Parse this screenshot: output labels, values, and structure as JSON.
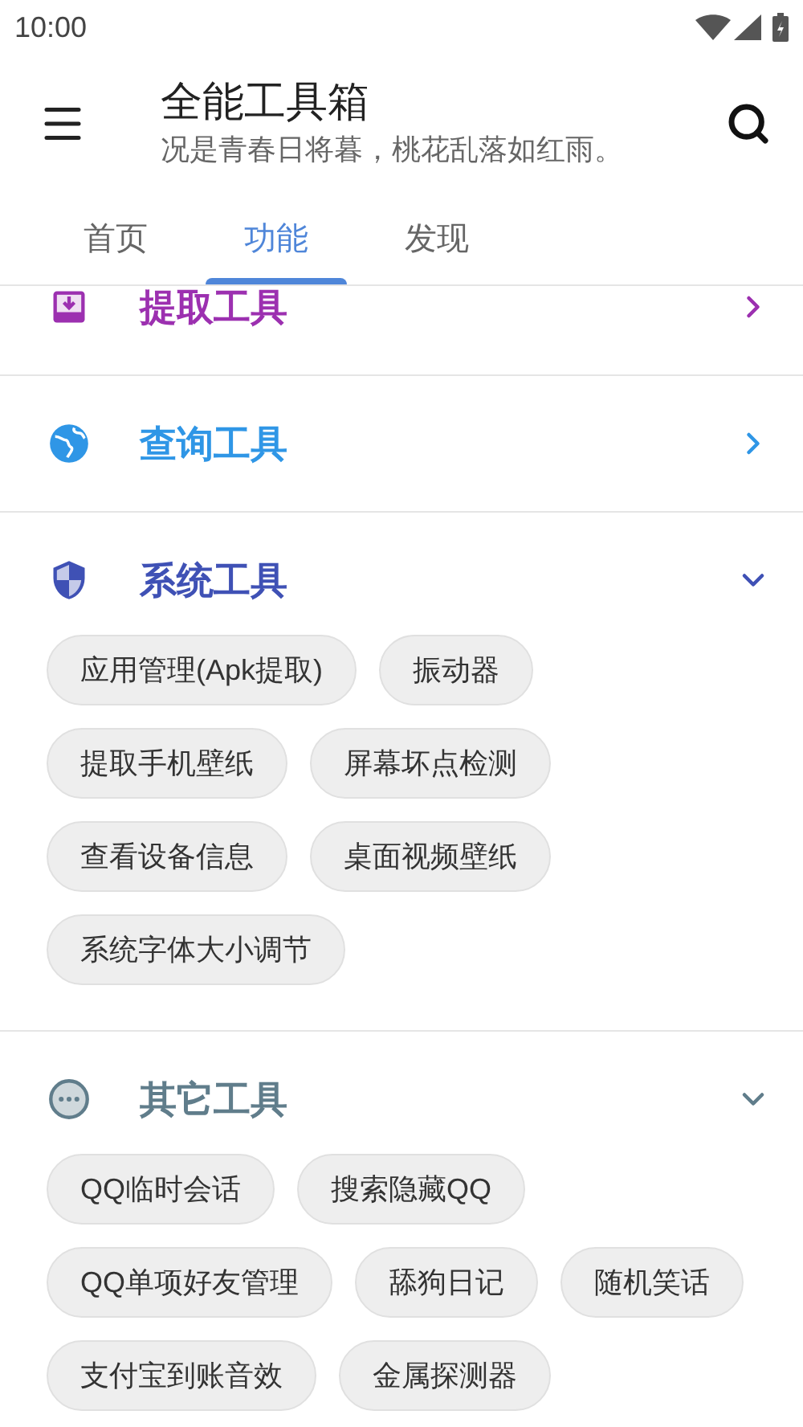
{
  "status_bar": {
    "time": "10:00"
  },
  "app_bar": {
    "title": "全能工具箱",
    "subtitle": "况是青春日将暮，桃花乱落如红雨。"
  },
  "tabs": [
    {
      "label": "首页",
      "selected": false
    },
    {
      "label": "功能",
      "selected": true
    },
    {
      "label": "发现",
      "selected": false
    }
  ],
  "sections": [
    {
      "kind": "download",
      "title": "提取工具",
      "color": "#9c30b0",
      "expanded": false
    },
    {
      "kind": "globe",
      "title": "查询工具",
      "color": "#2f96e6",
      "expanded": false
    },
    {
      "kind": "shield",
      "title": "系统工具",
      "color": "#3f51b5",
      "expanded": true,
      "tools": [
        "应用管理(Apk提取)",
        "振动器",
        "提取手机壁纸",
        "屏幕坏点检测",
        "查看设备信息",
        "桌面视频壁纸",
        "系统字体大小调节"
      ]
    },
    {
      "kind": "more",
      "title": "其它工具",
      "color": "#607d8b",
      "expanded": true,
      "tools": [
        "QQ临时会话",
        "搜索隐藏QQ",
        "QQ单项好友管理",
        "舔狗日记",
        "随机笑话",
        "支付宝到账音效",
        "金属探测器"
      ]
    }
  ]
}
